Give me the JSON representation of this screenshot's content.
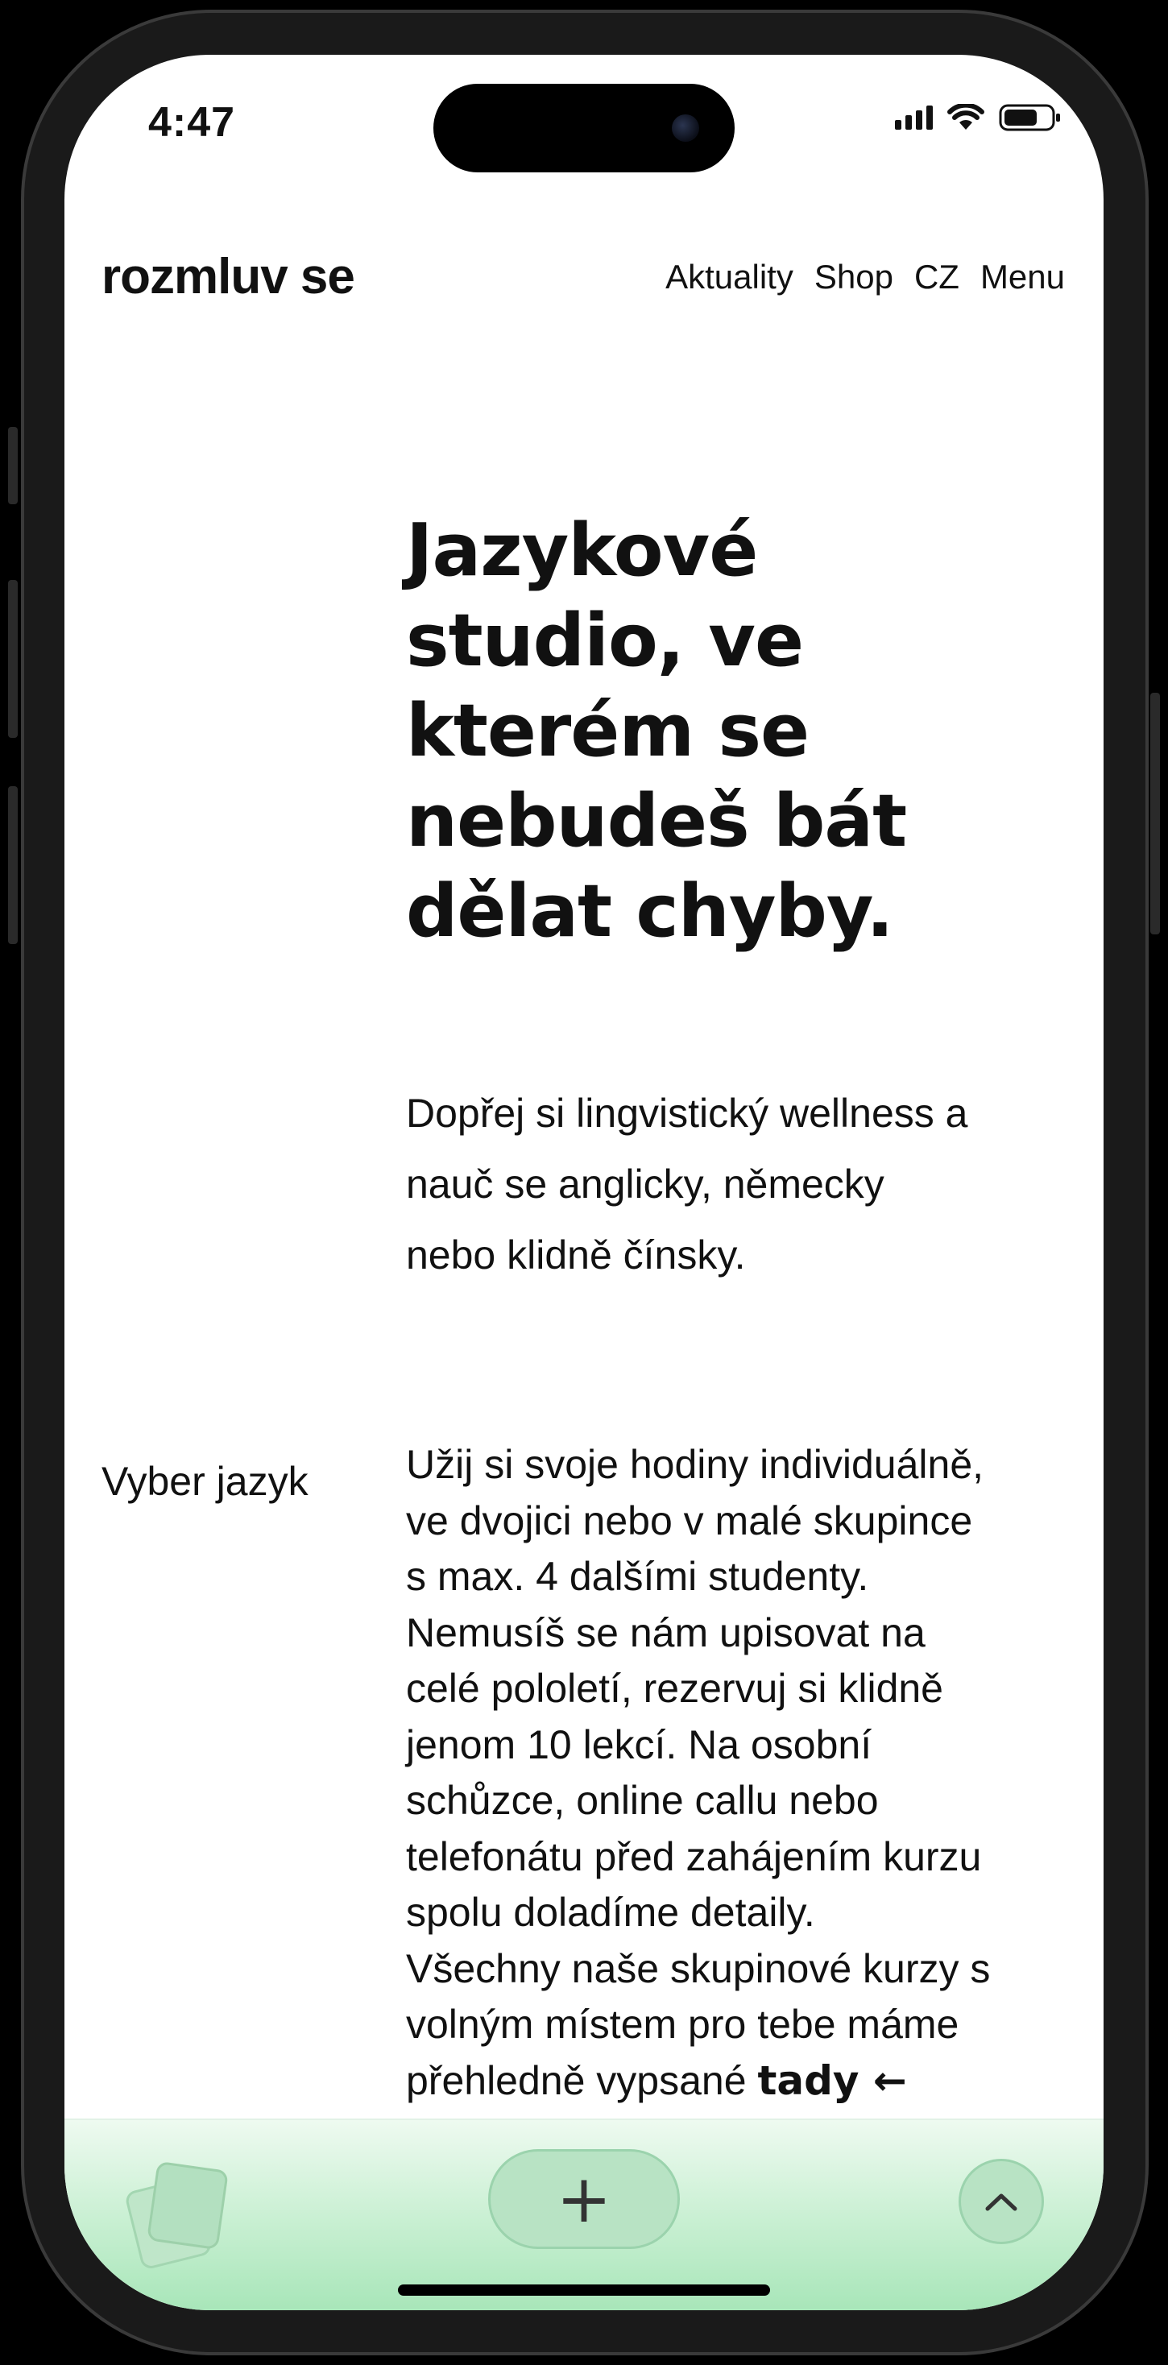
{
  "status": {
    "time": "4:47"
  },
  "header": {
    "logo": "rozmluv se",
    "nav": [
      "Aktuality",
      "Shop",
      "CZ",
      "Menu"
    ]
  },
  "hero": {
    "lines": [
      "Jazykové",
      "studio, ve",
      "kterém se",
      "nebudeš bát",
      "dělat chyby."
    ]
  },
  "lead": {
    "lines": [
      "Dopřej si lingvistický wellness a",
      "nauč se anglicky, německy",
      "nebo klidně čínsky."
    ]
  },
  "section": {
    "label": "Vyber jazyk",
    "lines": [
      "Užij si svoje hodiny individuálně,",
      "ve dvojici nebo v malé skupince",
      "s max. 4 dalšími studenty.",
      "Nemusíš se nám upisovat na",
      "celé pololetí, rezervuj si klidně",
      "jenom 10 lekcí. Na osobní",
      "schůzce, online callu nebo",
      "telefonátu před zahájením kurzu",
      "spolu doladíme detaily.",
      "Všechny naše skupinové kurzy s",
      "volným místem pro tebe máme"
    ],
    "last_line_prefix": "přehledně vypsané ",
    "link": "tady ←"
  },
  "bottom_bar": {
    "plus_label": "+",
    "left_icon": "cards-icon",
    "right_icon": "chevron-up-icon",
    "accent": "#a8e6b9"
  }
}
